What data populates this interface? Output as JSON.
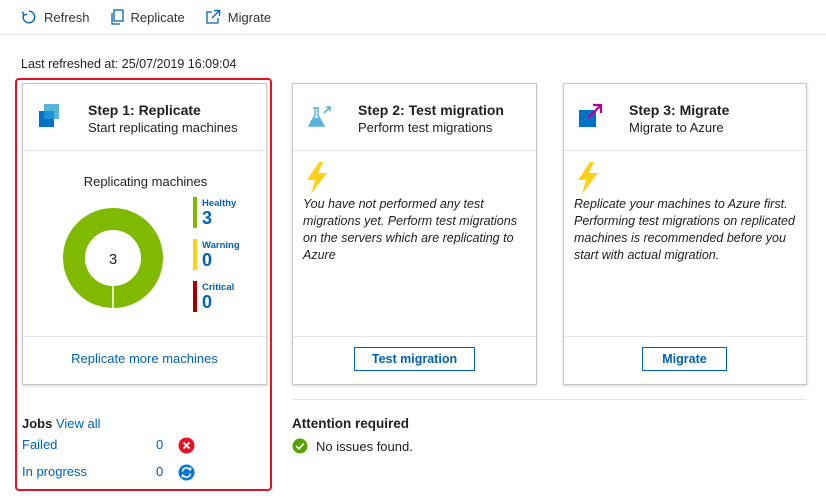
{
  "toolbar": {
    "refresh_label": "Refresh",
    "replicate_label": "Replicate",
    "migrate_label": "Migrate"
  },
  "last_refreshed": "Last refreshed at: 25/07/2019 16:09:04",
  "cards": {
    "replicate": {
      "title": "Step 1: Replicate",
      "subtitle": "Start replicating machines",
      "chart_title": "Replicating machines",
      "total": "3",
      "legend": [
        {
          "label": "Healthy",
          "value": "3",
          "color": "#7fba00"
        },
        {
          "label": "Warning",
          "value": "0",
          "color": "#fcd116"
        },
        {
          "label": "Critical",
          "value": "0",
          "color": "#a80000"
        }
      ],
      "footer_link": "Replicate more machines"
    },
    "test": {
      "title": "Step 2: Test migration",
      "subtitle": "Perform test migrations",
      "body": "You have not performed any test migrations yet. Perform test migrations on the servers which are replicating to Azure",
      "button": "Test migration"
    },
    "migrate": {
      "title": "Step 3: Migrate",
      "subtitle": "Migrate to Azure",
      "body": "Replicate your machines to Azure first. Performing test migrations on replicated machines is recommended before you start with actual migration.",
      "button": "Migrate"
    }
  },
  "jobs": {
    "title": "Jobs",
    "view_all": "View all",
    "rows": [
      {
        "label": "Failed",
        "count": "0",
        "icon": "error-icon"
      },
      {
        "label": "In progress",
        "count": "0",
        "icon": "sync-icon"
      }
    ]
  },
  "attention": {
    "title": "Attention required",
    "message": "No issues found."
  },
  "colors": {
    "accent": "#0063b1",
    "healthy": "#7fba00",
    "warning": "#fcd116",
    "critical": "#a80000",
    "highlight": "#e81123"
  }
}
